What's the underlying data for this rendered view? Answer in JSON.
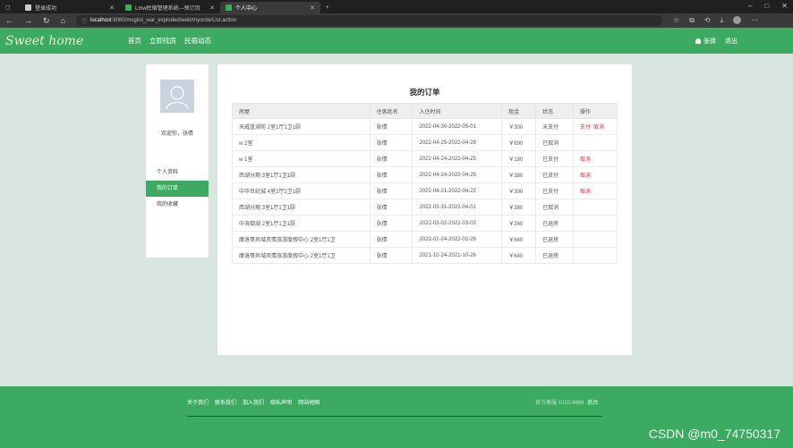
{
  "browser": {
    "tabs": [
      {
        "label": "登录成功",
        "active": false,
        "color": "#cccccc"
      },
      {
        "label": "Lmw民宿管理系统---预订页",
        "active": false,
        "color": "#3daa62"
      },
      {
        "label": "个人中心",
        "active": true,
        "color": "#3daa62"
      }
    ],
    "url_host": "localhost",
    "url_rest": ":8080/msglist_war_exploded/web/myorderList.action"
  },
  "site": {
    "logo": "Sweet home",
    "nav": [
      "首页",
      "立即找房",
      "民宿动态"
    ],
    "user_name": "张倩",
    "logout": "退出",
    "accent": "#3daa62"
  },
  "sidebar": {
    "welcome": "欢迎你，张倩",
    "items": [
      {
        "label": "个人资料",
        "active": false
      },
      {
        "label": "我的订单",
        "active": true
      },
      {
        "label": "我的收藏",
        "active": false
      }
    ]
  },
  "orders": {
    "title": "我的订单",
    "columns": [
      "房屋",
      "住客姓名",
      "入住时间",
      "租金",
      "状态",
      "操作"
    ],
    "rows": [
      {
        "house": "天威蓝湖苑 2室1厅1卫1厨",
        "guest": "张倩",
        "time": "2022-04-30-2022-05-01",
        "rent": "￥300",
        "status": "未支付",
        "ops": [
          "支付",
          "取消"
        ]
      },
      {
        "house": "w 2室",
        "guest": "张倩",
        "time": "2022-04-25-2022-04-28",
        "rent": "￥690",
        "status": "已取消",
        "ops": []
      },
      {
        "house": "w 1室",
        "guest": "张倩",
        "time": "2022-04-24-2022-04-25",
        "rent": "￥180",
        "status": "已支付",
        "ops": [
          "取消"
        ]
      },
      {
        "house": "西湖分期 3室1厅1卫1厨",
        "guest": "张倩",
        "time": "2022-04-24-2022-04-25",
        "rent": "￥380",
        "status": "已支付",
        "ops": [
          "取消"
        ]
      },
      {
        "house": "中华世纪城 4室2厅2卫1厨",
        "guest": "张倩",
        "time": "2022-04-21-2022-04-22",
        "rent": "￥300",
        "status": "已支付",
        "ops": [
          "取消"
        ]
      },
      {
        "house": "西湖分期 3室1厅1卫1厨",
        "guest": "张倩",
        "time": "2022-03-31-2022-04-01",
        "rent": "￥380",
        "status": "已取消",
        "ops": []
      },
      {
        "house": "中海御湖 2室1厅1卫1厨",
        "guest": "张倩",
        "time": "2022-03-02-2022-03-03",
        "rent": "￥260",
        "status": "已退房",
        "ops": []
      },
      {
        "house": "摩洛哥异域风情旅游度假中心 2室1厅1卫",
        "guest": "张倩",
        "time": "2022-02-24-2022-02-26",
        "rent": "￥640",
        "status": "已退房",
        "ops": []
      },
      {
        "house": "摩洛哥异域风情旅游度假中心 2室1厅1卫",
        "guest": "张倩",
        "time": "2021-10-24-2021-10-26",
        "rent": "￥640",
        "status": "已退房",
        "ops": []
      }
    ]
  },
  "footer": {
    "links": [
      "关于我们",
      "联系我们",
      "加入我们",
      "隐私声明",
      "网站地图"
    ],
    "phone_label": "官方客服 1010-9666",
    "phone_extra": "后台"
  },
  "watermark": "CSDN @m0_74750317"
}
